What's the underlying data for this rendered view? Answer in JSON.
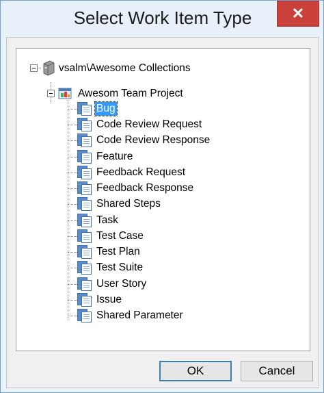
{
  "window": {
    "title": "Select Work Item Type",
    "close_glyph": "✕"
  },
  "tree": {
    "server": {
      "label": "vsalm\\Awesome Collections",
      "icon": "server-icon"
    },
    "project": {
      "label": "Awesom Team Project",
      "icon": "team-project-icon"
    },
    "items": [
      {
        "label": "Bug",
        "selected": true
      },
      {
        "label": "Code Review Request"
      },
      {
        "label": "Code Review Response"
      },
      {
        "label": "Feature"
      },
      {
        "label": "Feedback Request"
      },
      {
        "label": "Feedback Response"
      },
      {
        "label": "Shared Steps"
      },
      {
        "label": "Task"
      },
      {
        "label": "Test Case"
      },
      {
        "label": "Test Plan"
      },
      {
        "label": "Test Suite"
      },
      {
        "label": "User Story"
      },
      {
        "label": "Issue"
      },
      {
        "label": "Shared Parameter"
      }
    ]
  },
  "buttons": {
    "ok": "OK",
    "cancel": "Cancel"
  },
  "colors": {
    "selection": "#3399ff",
    "close": "#c9413a",
    "frame": "#6fa3d6"
  }
}
